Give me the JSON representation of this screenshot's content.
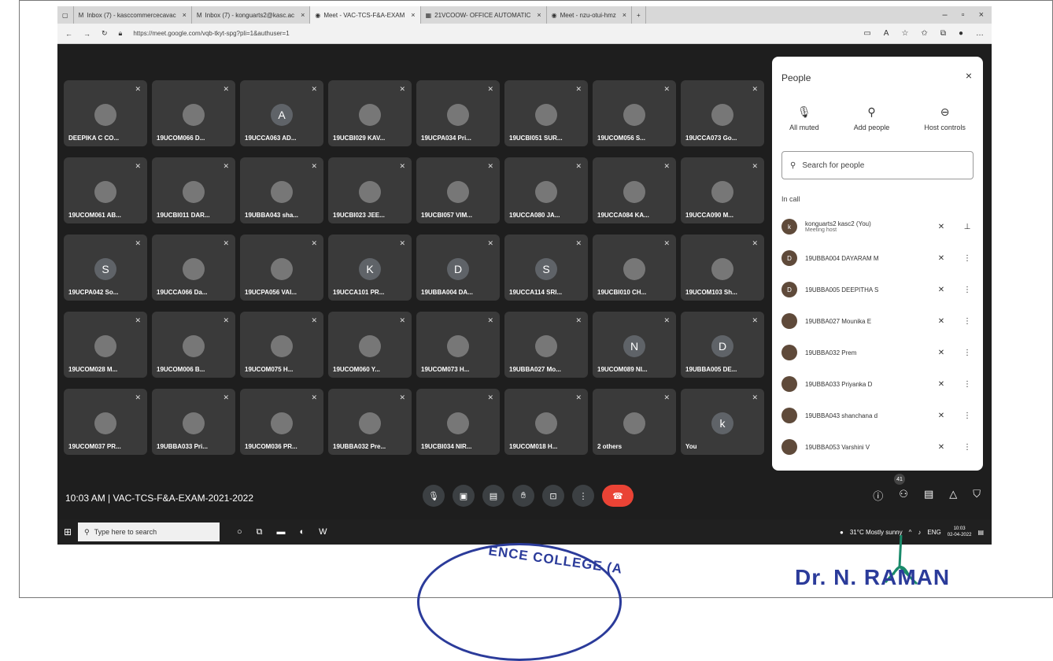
{
  "browser": {
    "tabs": [
      {
        "label": "Inbox (7) - kasccommercecavac",
        "icon": "gmail-icon"
      },
      {
        "label": "Inbox (7) - konguarts2@kasc.ac",
        "icon": "gmail-icon"
      },
      {
        "label": "Meet - VAC-TCS-F&A-EXAM",
        "icon": "meet-icon",
        "active": true
      },
      {
        "label": "21VCOOW- OFFICE AUTOMATIC",
        "icon": "sheets-icon"
      },
      {
        "label": "Meet - nzu-otui-hmz",
        "icon": "meet-icon"
      }
    ],
    "url": "https://meet.google.com/vqb-tkyt-spg?pli=1&authuser=1"
  },
  "participants": [
    {
      "name": "DEEPIKA C CO...",
      "avatar": "photo"
    },
    {
      "name": "19UCOM066 D...",
      "avatar": "photo"
    },
    {
      "name": "19UCCA063 AD...",
      "avatar": "A"
    },
    {
      "name": "19UCBI029 KAV...",
      "avatar": "photo"
    },
    {
      "name": "19UCPA034 Pri...",
      "avatar": "photo"
    },
    {
      "name": "19UCBI051 SUR...",
      "avatar": "photo"
    },
    {
      "name": "19UCOM056 S...",
      "avatar": "photo"
    },
    {
      "name": "19UCCA073 Go...",
      "avatar": "photo"
    },
    {
      "name": "19UCOM061 AB...",
      "avatar": "photo"
    },
    {
      "name": "19UCBI011 DAR...",
      "avatar": "photo"
    },
    {
      "name": "19UBBA043 sha...",
      "avatar": "photo"
    },
    {
      "name": "19UCBI023 JEE...",
      "avatar": "photo"
    },
    {
      "name": "19UCBI057 VIM...",
      "avatar": "photo"
    },
    {
      "name": "19UCCA080 JA...",
      "avatar": "photo"
    },
    {
      "name": "19UCCA084 KA...",
      "avatar": "photo"
    },
    {
      "name": "19UCCA090 M...",
      "avatar": "photo"
    },
    {
      "name": "19UCPA042 So...",
      "avatar": "S"
    },
    {
      "name": "19UCCA066 Da...",
      "avatar": "photo"
    },
    {
      "name": "19UCPA056 VAI...",
      "avatar": "photo"
    },
    {
      "name": "19UCCA101 PR...",
      "avatar": "K"
    },
    {
      "name": "19UBBA004 DA...",
      "avatar": "D"
    },
    {
      "name": "19UCCA114 SRI...",
      "avatar": "S"
    },
    {
      "name": "19UCBI010 CH...",
      "avatar": "photo"
    },
    {
      "name": "19UCOM103 Sh...",
      "avatar": "photo"
    },
    {
      "name": "19UCOM028 M...",
      "avatar": "photo"
    },
    {
      "name": "19UCOM006 B...",
      "avatar": "photo"
    },
    {
      "name": "19UCOM075 H...",
      "avatar": "photo"
    },
    {
      "name": "19UCOM060 Y...",
      "avatar": "photo"
    },
    {
      "name": "19UCOM073 H...",
      "avatar": "photo"
    },
    {
      "name": "19UBBA027 Mo...",
      "avatar": "photo"
    },
    {
      "name": "19UCOM089 NI...",
      "avatar": "N"
    },
    {
      "name": "19UBBA005 DE...",
      "avatar": "D"
    },
    {
      "name": "19UCOM037 PR...",
      "avatar": "photo"
    },
    {
      "name": "19UBBA033 Pri...",
      "avatar": "photo"
    },
    {
      "name": "19UCOM036 PR...",
      "avatar": "photo"
    },
    {
      "name": "19UBBA032 Pre...",
      "avatar": "photo"
    },
    {
      "name": "19UCBI034 NIR...",
      "avatar": "photo"
    },
    {
      "name": "19UCOM018 H...",
      "avatar": "photo"
    },
    {
      "name": "2 others",
      "avatar": "photo"
    },
    {
      "name": "You",
      "avatar": "k"
    }
  ],
  "people_panel": {
    "title": "People",
    "actions": [
      {
        "label": "All muted",
        "icon": "mic-off-icon"
      },
      {
        "label": "Add people",
        "icon": "add-person-icon"
      },
      {
        "label": "Host controls",
        "icon": "toggle-icon"
      }
    ],
    "search_placeholder": "Search for people",
    "in_call_label": "In call",
    "list": [
      {
        "name": "konguarts2 kasc2 (You)",
        "sub": "Meeting host",
        "initial": "k"
      },
      {
        "name": "19UBBA004 DAYARAM M",
        "initial": "D"
      },
      {
        "name": "19UBBA005 DEEPITHA S",
        "initial": "D"
      },
      {
        "name": "19UBBA027 Mounika E",
        "initial": ""
      },
      {
        "name": "19UBBA032 Prem",
        "initial": ""
      },
      {
        "name": "19UBBA033 Priyanka D",
        "initial": ""
      },
      {
        "name": "19UBBA043 shanchana d",
        "initial": ""
      },
      {
        "name": "19UBBA053 Varshini V",
        "initial": ""
      }
    ]
  },
  "meeting": {
    "info": "10:03 AM | VAC-TCS-F&A-EXAM-2021-2022",
    "participant_count": "41"
  },
  "taskbar": {
    "search_placeholder": "Type here to search",
    "weather": "31°C  Mostly sunny",
    "lang": "ENG",
    "time": "10:03",
    "date": "02-04-2022"
  },
  "stamp": {
    "seal_text": "ENCE COLLEGE (A",
    "signature_name": "Dr. N. RAMAN"
  }
}
